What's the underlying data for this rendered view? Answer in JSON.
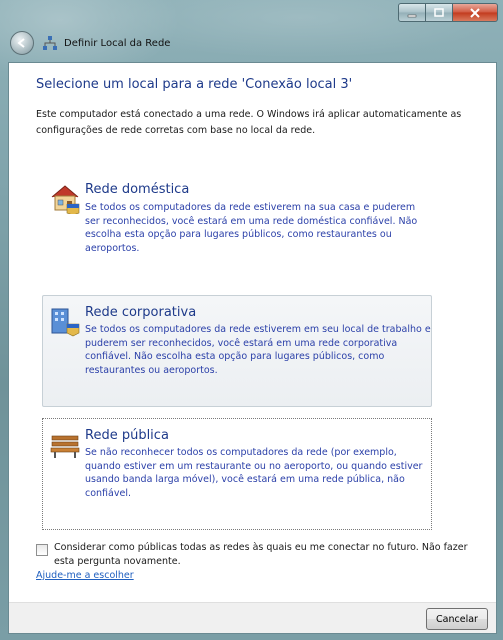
{
  "window": {
    "title": "Definir Local da Rede",
    "buttons": {
      "minimize": "minimize",
      "maximize": "maximize",
      "close": "close"
    }
  },
  "content": {
    "heading": "Selecione um local para a rede 'Conexão local 3'",
    "intro": "Este computador está conectado a uma rede. O Windows irá aplicar automaticamente as configurações de rede corretas com base no local da rede."
  },
  "options": [
    {
      "title": "Rede doméstica",
      "description": "Se todos os computadores da rede estiverem na sua casa e puderem ser reconhecidos, você estará em uma rede doméstica confiável. Não escolha esta opção para lugares públicos, como restaurantes ou aeroportos.",
      "icon": "house-icon"
    },
    {
      "title": "Rede corporativa",
      "description": "Se todos os computadores da rede estiverem em seu local de trabalho e puderem ser reconhecidos, você estará em uma rede corporativa confiável. Não escolha esta opção para lugares públicos, como restaurantes ou aeroportos.",
      "icon": "office-building-icon"
    },
    {
      "title": "Rede pública",
      "description": "Se não reconhecer todos os computadores da rede (por exemplo, quando estiver em um restaurante ou no aeroporto, ou quando estiver usando banda larga móvel), você estará em uma rede pública, não confiável.",
      "icon": "park-bench-icon"
    }
  ],
  "checkbox": {
    "label": "Considerar como públicas todas as redes às quais eu me conectar no futuro. Não fazer esta pergunta novamente.",
    "checked": false
  },
  "help_link": "Ajude-me a escolher",
  "footer": {
    "cancel_label": "Cancelar"
  },
  "colors": {
    "heading": "#1e3a8a",
    "link": "#1f5fbf",
    "close_button": "#c23a1d"
  }
}
